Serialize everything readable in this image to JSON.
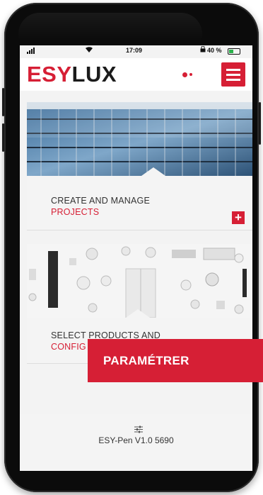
{
  "status_bar": {
    "time": "17:09",
    "battery": "40 %"
  },
  "header": {
    "logo_red": "ESY",
    "logo_dark": "LUX",
    "menu_icon": "hamburger-menu-icon",
    "brand_color": "#d61f35"
  },
  "cards": [
    {
      "title": "CREATE AND MANAGE",
      "subtitle": "PROJECTS",
      "action_icon": "plus-icon",
      "action_symbol": "+"
    },
    {
      "title": "SELECT PRODUCTS AND",
      "subtitle": "CONFIG"
    }
  ],
  "footer": {
    "icon": "sliders-icon",
    "label": "ESY-Pen V1.0 5690"
  },
  "overlay": {
    "label": "PARAMÉTRER"
  }
}
